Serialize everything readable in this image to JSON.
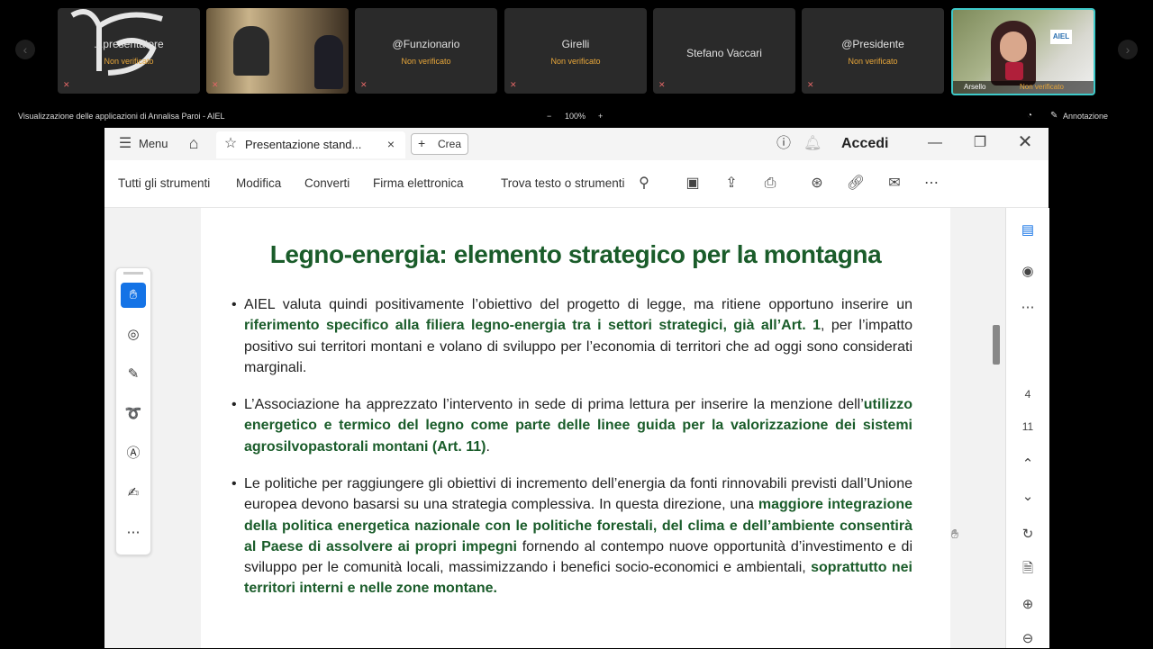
{
  "participants": [
    {
      "name": "...presentatore",
      "status": "Non verificato"
    },
    {
      "name": "",
      "status": ""
    },
    {
      "name": "@Funzionario",
      "status": "Non verificato"
    },
    {
      "name": "Girelli",
      "status": "Non verificato"
    },
    {
      "name": "Stefano Vaccari",
      "status": ""
    },
    {
      "name": "@Presidente",
      "status": "Non verificato"
    },
    {
      "name": "Arsello",
      "status": "Non verificato"
    }
  ],
  "sharebar": {
    "label": "Visualizzazione delle applicazioni di Annalisa Paroi - AIEL",
    "zoom": "100%",
    "zoom_minus": "−",
    "zoom_plus": "+",
    "annotation": "Annotazione"
  },
  "window": {
    "menu_label": "Menu",
    "tab_title": "Presentazione stand...",
    "create_label": "Crea",
    "signin_label": "Accedi"
  },
  "toolbar": {
    "all_tools": "Tutti gli strumenti",
    "edit": "Modifica",
    "convert": "Converti",
    "esign": "Firma elettronica",
    "find": "Trova testo o strumenti"
  },
  "document": {
    "title": "Legno-energia: elemento strategico per la montagna",
    "b1_p1": "AIEL valuta quindi positivamente l’obiettivo del progetto di legge, ma ritiene opportuno inserire un ",
    "b1_g1": "riferimento specifico alla filiera legno-energia tra i settori strategici, già all’Art. 1",
    "b1_p2": ", per l’impatto positivo sui territori montani e volano di sviluppo per l’economia di territori che ad oggi sono considerati marginali.",
    "b2_p1": "L’Associazione ha apprezzato l’intervento in sede di prima lettura per inserire la menzione dell’",
    "b2_g1": "utilizzo energetico e termico del legno come parte delle linee guida per la valorizzazione dei sistemi agrosilvopastorali montani (Art. 11)",
    "b2_p2": ".",
    "b3_p1": "Le politiche per raggiungere gli obiettivi di incremento dell’energia da fonti rinnovabili previsti dall’Unione europea devono basarsi su una strategia complessiva. In questa direzione, una ",
    "b3_g1": "maggiore integrazione della politica energetica nazionale con le politiche forestali, del clima e dell’ambiente consentirà al Paese di assolvere ai propri impegni",
    "b3_p2": " fornendo al contempo nuove opportunità d’investimento e di sviluppo per le comunità locali, massimizzando i benefici socio-economici e ambientali, ",
    "b3_g2": "soprattutto nei territori interni e nelle zone montane."
  },
  "pages": {
    "current": "4",
    "total": "11"
  },
  "colors": {
    "accent_green": "#1a5c2a",
    "active_tile_border": "#3ec9c9",
    "tool_active": "#1473e6"
  }
}
